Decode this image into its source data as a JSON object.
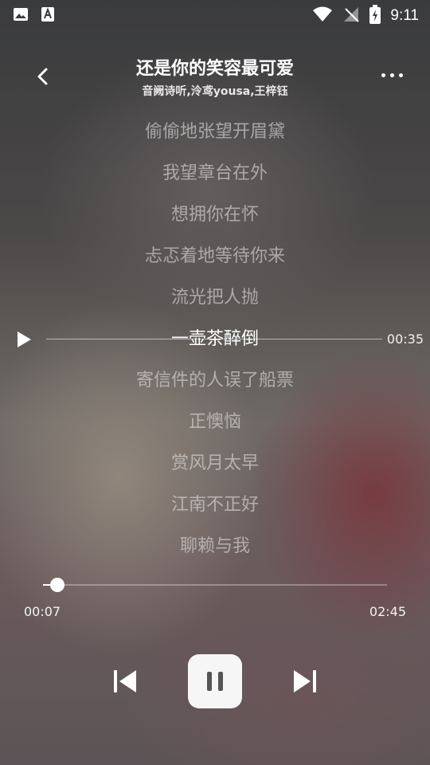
{
  "status_bar": {
    "time": "9:11",
    "left_icons": [
      "image-icon",
      "text-a-icon"
    ],
    "right_icons": [
      "wifi-icon",
      "no-signal-icon",
      "battery-charging-icon"
    ]
  },
  "header": {
    "title": "还是你的笑容最可爱",
    "artists": "音阙诗听,泠鸢yousa,王梓钰"
  },
  "lyrics": [
    "偷偷地张望开眉黛",
    "我望章台在外",
    "想拥你在怀",
    "忐忑着地等待你来",
    "流光把人抛",
    "一壶茶醉倒",
    "寄信件的人误了船票",
    "正懊恼",
    "赏风月太早",
    "江南不正好",
    "聊赖与我"
  ],
  "active_lyric_index": 5,
  "seek_preview": {
    "time": "00:35"
  },
  "progress": {
    "current": "00:07",
    "duration": "02:45",
    "fraction": 0.042
  },
  "controls": {
    "state": "playing"
  },
  "colors": {
    "accent": "#ffffff",
    "pause_bg": "#f2f2f2"
  }
}
